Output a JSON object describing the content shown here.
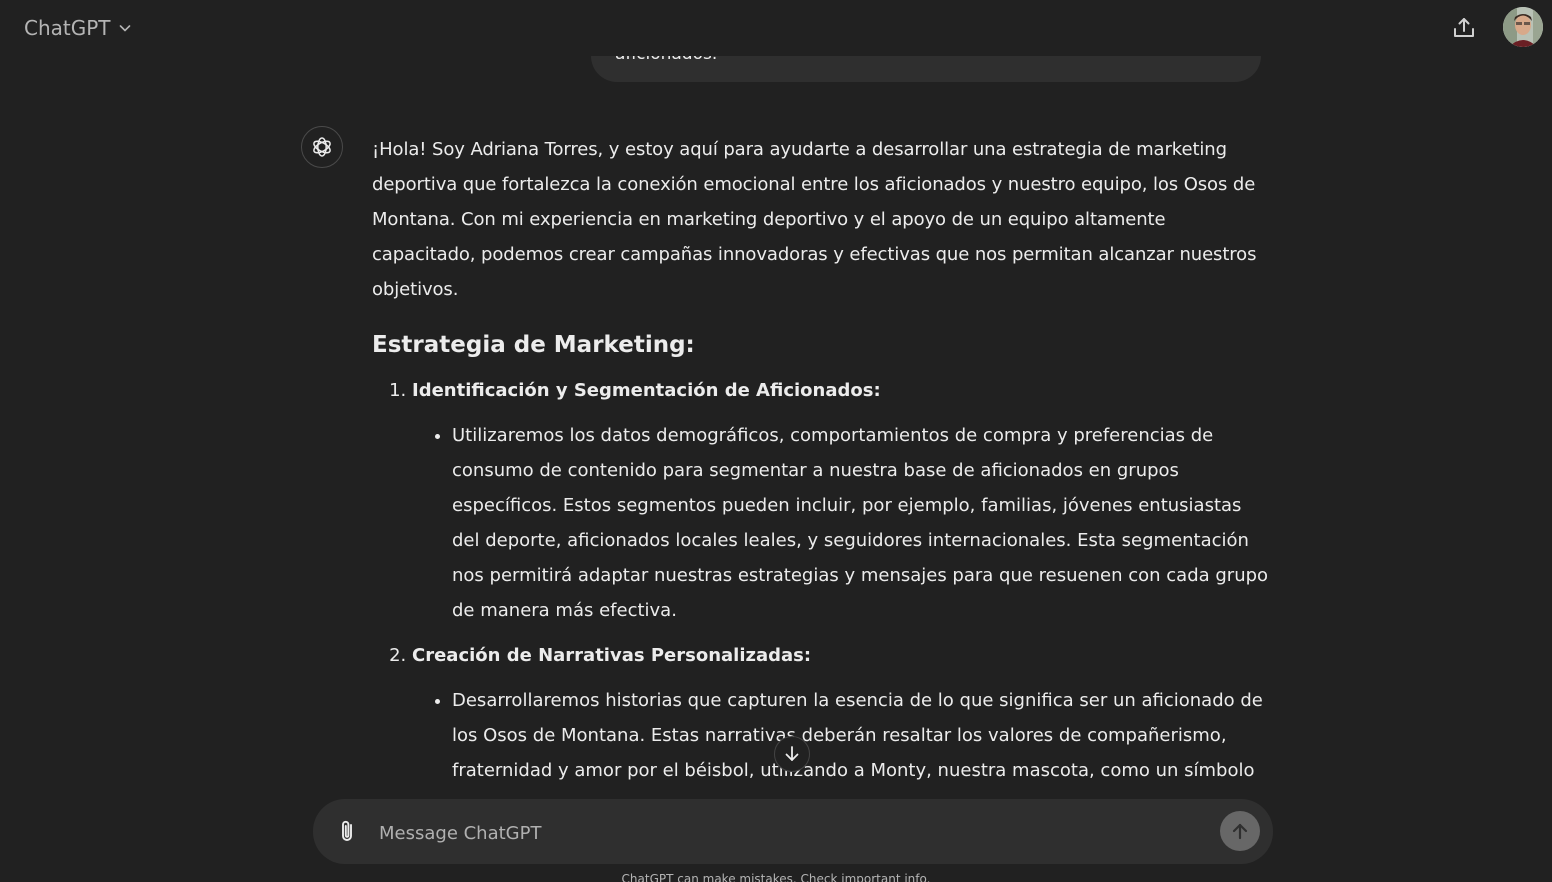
{
  "header": {
    "model_name": "ChatGPT",
    "icons": {
      "model_dropdown": "chevron-down-icon",
      "share": "upload-icon",
      "avatar": "user-avatar"
    }
  },
  "conversation": {
    "previous_user_message_tail": "aficionados.",
    "assistant": {
      "intro": "¡Hola! Soy Adriana Torres, y estoy aquí para ayudarte a desarrollar una estrategia de marketing deportiva que fortalezca la conexión emocional entre los aficionados y nuestro equipo, los Osos de Montana. Con mi experiencia en marketing deportivo y el apoyo de un equipo altamente capacitado, podemos crear campañas innovadoras y efectivas que nos permitan alcanzar nuestros objetivos.",
      "heading": "Estrategia de Marketing:",
      "steps": [
        {
          "title": "Identificación y Segmentación de Aficionados:",
          "bullet": "Utilizaremos los datos demográficos, comportamientos de compra y preferencias de consumo de contenido para segmentar a nuestra base de aficionados en grupos específicos. Estos segmentos pueden incluir, por ejemplo, familias, jóvenes entusiastas del deporte, aficionados locales leales, y seguidores internacionales. Esta segmentación nos permitirá adaptar nuestras estrategias y mensajes para que resuenen con cada grupo de manera más efectiva."
        },
        {
          "title": "Creación de Narrativas Personalizadas:",
          "bullet": "Desarrollaremos historias que capturen la esencia de lo que significa ser un aficionado de los Osos de Montana. Estas narrativas deberán resaltar los valores de compañerismo, fraternidad y amor por el béisbol, utilizando a Monty, nuestra mascota, como un símbolo central. Cada segmento de aficionados recibirá contenido que les hable directamente,"
        }
      ]
    }
  },
  "composer": {
    "placeholder": "Message ChatGPT",
    "value": ""
  },
  "footer": {
    "note": "ChatGPT can make mistakes. Check important info."
  }
}
